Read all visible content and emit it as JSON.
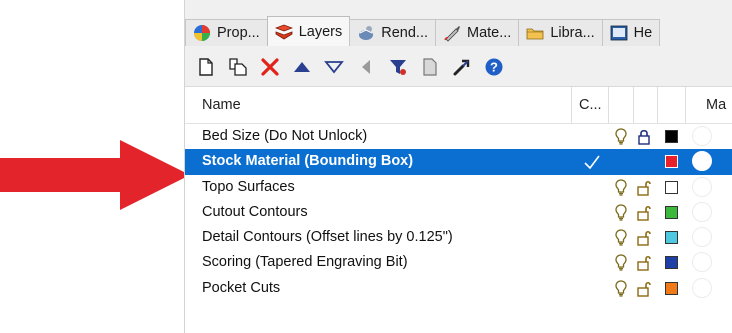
{
  "tabs": [
    {
      "label": "Prop...",
      "icon": "properties-icon",
      "active": false
    },
    {
      "label": "Layers",
      "icon": "layers-icon",
      "active": true
    },
    {
      "label": "Rend...",
      "icon": "rendering-icon",
      "active": false
    },
    {
      "label": "Mate...",
      "icon": "materials-icon",
      "active": false
    },
    {
      "label": "Libra...",
      "icon": "libraries-icon",
      "active": false
    },
    {
      "label": "He",
      "icon": "help-icon",
      "active": false
    }
  ],
  "toolbar": [
    "new-layer-icon",
    "new-sublayer-icon",
    "delete-layer-icon",
    "move-up-icon",
    "move-down-icon",
    "move-out-icon",
    "filter-icon",
    "copy-icon",
    "tools-icon",
    "help-icon"
  ],
  "columns": {
    "name": "Name",
    "current": "C...",
    "material": "Ma"
  },
  "layers": [
    {
      "name": "Bed Size (Do Not Unlock)",
      "locked": true,
      "color": "#000000",
      "selected": false,
      "current": false
    },
    {
      "name": "Stock Material (Bounding Box)",
      "locked": false,
      "color": "#e8202a",
      "selected": true,
      "current": true
    },
    {
      "name": "Topo Surfaces",
      "locked": false,
      "color": "#ffffff",
      "selected": false,
      "current": false
    },
    {
      "name": "Cutout Contours",
      "locked": false,
      "color": "#3cb83c",
      "selected": false,
      "current": false
    },
    {
      "name": "Detail Contours (Offset lines by 0.125\")",
      "locked": false,
      "color": "#4dc8e0",
      "selected": false,
      "current": false
    },
    {
      "name": "Scoring (Tapered Engraving Bit)",
      "locked": false,
      "color": "#1f3fa8",
      "selected": false,
      "current": false
    },
    {
      "name": "Pocket Cuts",
      "locked": false,
      "color": "#f07a18",
      "selected": false,
      "current": false
    }
  ],
  "colors": {
    "selection": "#0a6fd0",
    "arrow": "#e3242b"
  }
}
